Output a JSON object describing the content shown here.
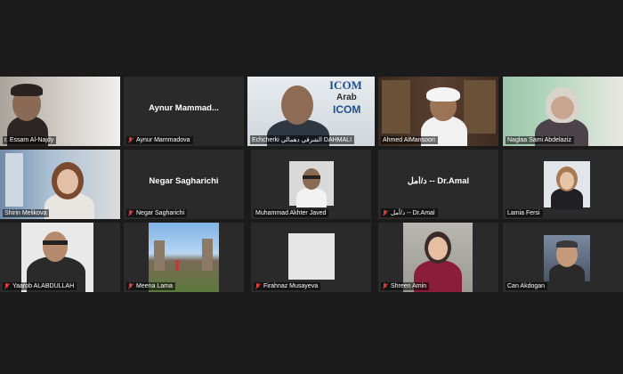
{
  "participants": [
    {
      "name": "r. Essam Al-Najdy",
      "muted": false,
      "display": "video"
    },
    {
      "name": "Aynur Mammadova",
      "center_text": "Aynur  Mammad...",
      "muted": true,
      "display": "name"
    },
    {
      "name": "Echcherki ‎الشرقي دهمالي DAHMALI",
      "muted": false,
      "display": "video",
      "active": true,
      "logo_top": "ICOM",
      "logo_mid": "Arab",
      "logo_bottom": "ICOM"
    },
    {
      "name": "Ahmed AlMansoori",
      "muted": false,
      "display": "video"
    },
    {
      "name": "Naglaa Sami Abdelaziz",
      "muted": false,
      "display": "video"
    },
    {
      "name": "Shirin Melikova",
      "muted": false,
      "display": "video"
    },
    {
      "name": "Negar Sagharichi",
      "center_text": "Negar Sagharichi",
      "muted": true,
      "display": "name"
    },
    {
      "name": "Muhammad Akhter Javed",
      "muted": false,
      "display": "photo"
    },
    {
      "name": "د/أمل -- Dr.Amal",
      "center_text": "د/أمل -- Dr.Amal",
      "muted": true,
      "display": "name"
    },
    {
      "name": "Lamia Fersi",
      "muted": false,
      "display": "photo"
    },
    {
      "name": "Yaarob ALABDULLAH",
      "muted": true,
      "display": "video"
    },
    {
      "name": "Meena Lama",
      "muted": true,
      "display": "video"
    },
    {
      "name": "Firahnaz Musayeva",
      "muted": true,
      "display": "photo"
    },
    {
      "name": "Shreen Amin",
      "muted": true,
      "display": "photo"
    },
    {
      "name": "Can Akdogan",
      "muted": false,
      "display": "photo"
    }
  ]
}
